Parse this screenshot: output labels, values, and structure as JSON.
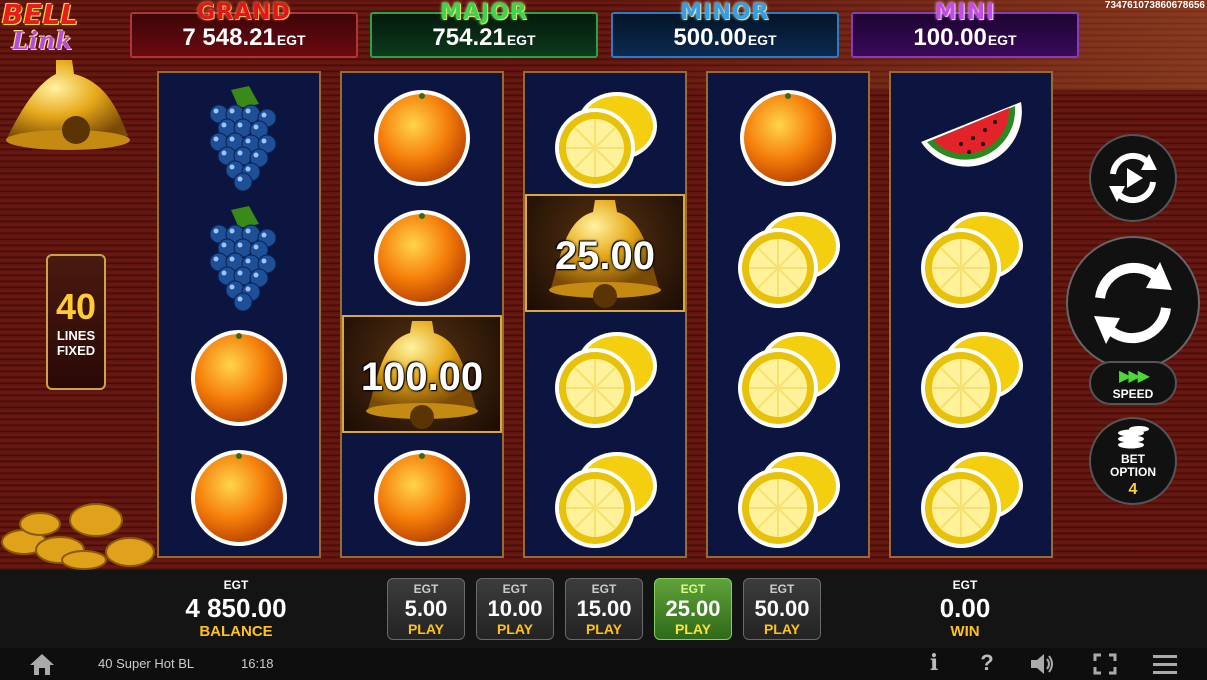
{
  "logo": {
    "line1": "BELL",
    "line2": "Link"
  },
  "ticket_id": "734761073860678656",
  "jackpots": [
    {
      "name": "GRAND",
      "value": "7 548.21",
      "currency": "EGT",
      "color": "#e3141c"
    },
    {
      "name": "MAJOR",
      "value": "754.21",
      "currency": "EGT",
      "color": "#38d84e"
    },
    {
      "name": "MINOR",
      "value": "500.00",
      "currency": "EGT",
      "color": "#2da0f0"
    },
    {
      "name": "MINI",
      "value": "100.00",
      "currency": "EGT",
      "color": "#c24ce8"
    }
  ],
  "lines_badge": {
    "count": "40",
    "line1": "LINES",
    "line2": "FIXED"
  },
  "reels": [
    [
      "grapes",
      "grapes",
      "orange",
      "orange"
    ],
    [
      "orange",
      "orange",
      "bell",
      "orange"
    ],
    [
      "lemon",
      "bell",
      "lemon",
      "lemon"
    ],
    [
      "orange",
      "lemon",
      "lemon",
      "lemon"
    ],
    [
      "watermelon",
      "lemon",
      "lemon",
      "lemon"
    ]
  ],
  "bell_values": {
    "reel2": "100.00",
    "reel3": "25.00"
  },
  "controls": {
    "autoplay_icon": "autoplay-icon",
    "spin_icon": "spin-icon",
    "speed_label": "SPEED",
    "speed_arrows": "▶▶▶",
    "bet_option_label_1": "BET",
    "bet_option_label_2": "OPTION",
    "bet_option_value": "4"
  },
  "balance": {
    "currency": "EGT",
    "value": "4 850.00",
    "label": "BALANCE"
  },
  "win": {
    "currency": "EGT",
    "value": "0.00",
    "label": "WIN"
  },
  "bets": [
    {
      "currency": "EGT",
      "value": "5.00",
      "label": "PLAY",
      "selected": false
    },
    {
      "currency": "EGT",
      "value": "10.00",
      "label": "PLAY",
      "selected": false
    },
    {
      "currency": "EGT",
      "value": "15.00",
      "label": "PLAY",
      "selected": false
    },
    {
      "currency": "EGT",
      "value": "25.00",
      "label": "PLAY",
      "selected": true
    },
    {
      "currency": "EGT",
      "value": "50.00",
      "label": "PLAY",
      "selected": false
    }
  ],
  "footer": {
    "game_name": "40 Super Hot BL",
    "time": "16:18",
    "info": "i",
    "help": "?"
  },
  "colors": {
    "accent_gold": "#ffc21a",
    "reel_bg": "#0c1540",
    "selected_bet": "#5fa23a"
  }
}
